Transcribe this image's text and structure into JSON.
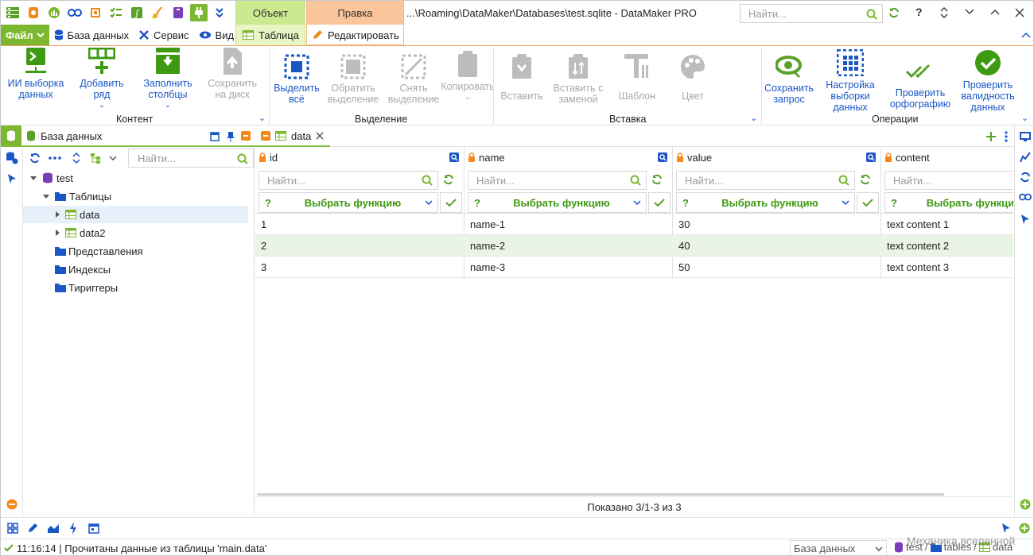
{
  "app": {
    "title": "...\\Roaming\\DataMaker\\Databases\\test.sqlite - DataMaker PRO",
    "search_placeholder": "Найти...",
    "brand_color": "#86c440",
    "accent_color": "#1a56c5"
  },
  "menu": {
    "file": "Файл",
    "database": "База данных",
    "service": "Сервис",
    "view": "Вид",
    "ctx_object": "Объект",
    "ctx_table": "Таблица",
    "ctx_edit_header": "Правка",
    "ctx_edit": "Редактировать"
  },
  "ribbon": {
    "ai_select": "ИИ выборка данных",
    "add_row": "Добавить ряд",
    "fill_columns": "Заполнить столбцы",
    "save_disk": "Сохранить на диск",
    "group_content": "Контент",
    "select_all": "Выделить всё",
    "invert_selection": "Обратить выделение",
    "clear_selection": "Снять выделение",
    "copy": "Копировать",
    "group_selection": "Выделение",
    "paste": "Вставить",
    "paste_replace": "Вставить с заменой",
    "template": "Шаблон",
    "color": "Цвет",
    "group_insert": "Вставка",
    "save_query": "Сохранить запрос",
    "setup_select": "Настройка выборки данных",
    "spellcheck": "Проверить орфографию",
    "validate": "Проверить валидность данных",
    "group_operations": "Операции"
  },
  "left_panel": {
    "tab": "База данных",
    "search_placeholder": "Найти...",
    "tree": {
      "db": "test",
      "tables": "Таблицы",
      "table1": "data",
      "table2": "data2",
      "views": "Представления",
      "indexes": "Индексы",
      "triggers": "Тириггеры"
    }
  },
  "doc_tab": {
    "label": "data"
  },
  "grid": {
    "columns": [
      "id",
      "name",
      "value",
      "content"
    ],
    "filter_placeholder": "Найти...",
    "function_label": "Выбрать функцию",
    "function_hint": "?",
    "rows": [
      [
        "1",
        "name-1",
        "30",
        "text content 1"
      ],
      [
        "2",
        "name-2",
        "40",
        "text content 2"
      ],
      [
        "3",
        "name-3",
        "50",
        "text content 3"
      ]
    ],
    "shown": "Показано 3/1-3 из 3"
  },
  "status": {
    "message": "11:16:14 | Прочитаны данные из таблицы 'main.data'",
    "db_select": "База данных",
    "crumb_db": "test",
    "crumb_tables": "tables",
    "crumb_table": "data",
    "watermark": "Механика вселенной"
  }
}
